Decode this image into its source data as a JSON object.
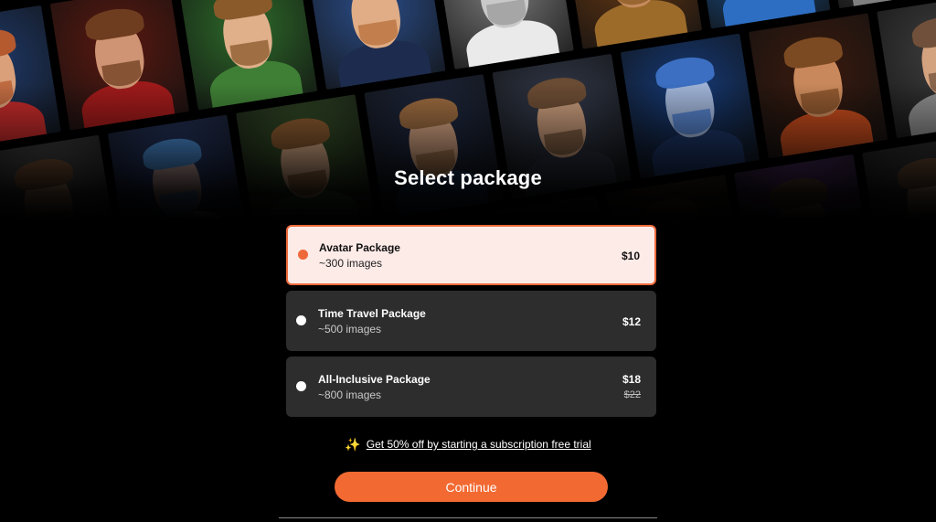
{
  "page": {
    "title": "Select package"
  },
  "packages": [
    {
      "name": "Avatar Package",
      "count": "~300 images",
      "price": "$10",
      "old_price": "",
      "selected": true
    },
    {
      "name": "Time Travel Package",
      "count": "~500 images",
      "price": "$12",
      "old_price": "",
      "selected": false
    },
    {
      "name": "All-Inclusive Package",
      "count": "~800 images",
      "price": "$18",
      "old_price": "$22",
      "selected": false
    }
  ],
  "promo": {
    "icon": "sparkles-icon",
    "text": "Get 50% off by starting a subscription free trial"
  },
  "actions": {
    "continue_label": "Continue"
  },
  "colors": {
    "accent": "#f26a32",
    "selected_bg": "#fdebe8",
    "card_bg": "#2d2d2d",
    "page_bg": "#000000"
  },
  "collage": {
    "portraits": [
      {
        "bg": "#1f3a6b",
        "skin": "#d9a07a",
        "hair": "#b5592f",
        "body": "#c22a2a"
      },
      {
        "bg": "#5a1810",
        "skin": "#cf9473",
        "hair": "#6e3d20",
        "body": "#9e1a1a"
      },
      {
        "bg": "#2e6b2a",
        "skin": "#e0b08b",
        "hair": "#8a5a2b",
        "body": "#3f7f35"
      },
      {
        "bg": "#2b4e8a",
        "skin": "#e0ad86",
        "hair": "#b8703a",
        "body": "#1d2c4e"
      },
      {
        "bg": "#7c7c7c",
        "skin": "#c9c9c9",
        "hair": "#9a9a9a",
        "body": "#eaeaea"
      },
      {
        "bg": "#6b3a14",
        "skin": "#c68b5e",
        "hair": "#8a5a24",
        "body": "#9c6b2a"
      },
      {
        "bg": "#1c5fa8",
        "skin": "#d39b77",
        "hair": "#6b4325",
        "body": "#2d6ec2"
      },
      {
        "bg": "#4b4b4b",
        "skin": "#d2a07c",
        "hair": "#6a4a33",
        "body": "#7f7f7f"
      },
      {
        "bg": "#5a5a5a",
        "skin": "#d29e78",
        "hair": "#7b5336",
        "body": "#cfcfcf"
      },
      {
        "bg": "#2a3f78",
        "skin": "#c7a3a0",
        "hair": "#4b8fd8",
        "body": "#e6e9f2"
      },
      {
        "bg": "#3b5a2b",
        "skin": "#e1b18c",
        "hair": "#8a5a2f",
        "body": "#3d6b31"
      },
      {
        "bg": "#1f2a45",
        "skin": "#d8a684",
        "hair": "#9a6a3f",
        "body": "#1f3b64"
      },
      {
        "bg": "#333b4d",
        "skin": "#c79a7a",
        "hair": "#6a4b33",
        "body": "#2a2f3d"
      },
      {
        "bg": "#153b7a",
        "skin": "#9fb3d6",
        "hair": "#3c6fc2",
        "body": "#1d3566"
      },
      {
        "bg": "#3a1a0e",
        "skin": "#c9885b",
        "hair": "#7c4a22",
        "body": "#c24a1c"
      },
      {
        "bg": "#3e3e3e",
        "skin": "#d3a27f",
        "hair": "#70503a",
        "body": "#8a8a8a"
      },
      {
        "bg": "#2b2b2b",
        "skin": "#c99a78",
        "hair": "#5a4130",
        "body": "#5d5d5d"
      },
      {
        "bg": "#444444",
        "skin": "#d09e7a",
        "hair": "#6b4a34",
        "body": "#3a3a3a"
      },
      {
        "bg": "#2d3645",
        "skin": "#c59a7e",
        "hair": "#5e4634",
        "body": "#20262f"
      },
      {
        "bg": "#3c3c3c",
        "skin": "#caa080",
        "hair": "#6a4c36",
        "body": "#2a2a2a"
      },
      {
        "bg": "#2a2430",
        "skin": "#b98f75",
        "hair": "#50382a",
        "body": "#1e1a22"
      },
      {
        "bg": "#4a3320",
        "skin": "#c99470",
        "hair": "#6b4a2c",
        "body": "#7a3a1a"
      },
      {
        "bg": "#6b3b8c",
        "skin": "#c99a86",
        "hair": "#6a4a3a",
        "body": "#4d2a66"
      },
      {
        "bg": "#404040",
        "skin": "#cfa07e",
        "hair": "#6b4b35",
        "body": "#5f5f5f"
      }
    ]
  }
}
